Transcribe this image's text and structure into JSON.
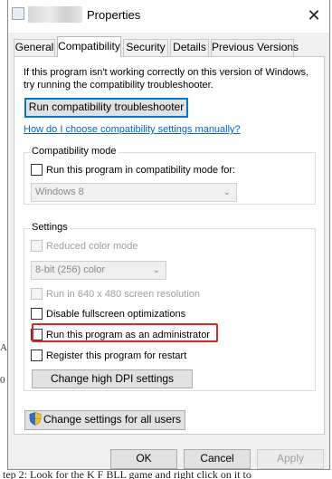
{
  "window": {
    "title": "Properties"
  },
  "tabs": [
    {
      "label": "General",
      "active": false
    },
    {
      "label": "Compatibility",
      "active": true
    },
    {
      "label": "Security",
      "active": false
    },
    {
      "label": "Details",
      "active": false
    },
    {
      "label": "Previous Versions",
      "active": false
    }
  ],
  "compat": {
    "intro_line1": "If this program isn't working correctly on this version of Windows,",
    "intro_line2": "try running the compatibility troubleshooter.",
    "troubleshooter_button": "Run compatibility troubleshooter",
    "manual_link": "How do I choose compatibility settings manually?",
    "mode_group": "Compatibility mode",
    "mode_checkbox": "Run this program in compatibility mode for:",
    "mode_select": "Windows 8",
    "settings_group": "Settings",
    "reduced_color": "Reduced color mode",
    "color_select": "8-bit (256) color",
    "res_640": "Run in 640 x 480 screen resolution",
    "disable_fullscreen": "Disable fullscreen optimizations",
    "run_as_admin": "Run this program as an administrator",
    "register_restart": "Register this program for restart",
    "dpi_button": "Change high DPI settings",
    "all_users_button": "Change settings for all users"
  },
  "footer": {
    "ok": "OK",
    "cancel": "Cancel",
    "apply": "Apply"
  },
  "background_text": {
    "bottom": "tep 2: Look for the K F BLL game and right click on it to",
    "left_marks": [
      "A",
      "0"
    ]
  },
  "colors": {
    "highlight": "#e0262b",
    "link": "#0066cc",
    "focus": "#0078d7"
  },
  "icons": {
    "close": "close-icon",
    "shield": "uac-shield-icon"
  }
}
